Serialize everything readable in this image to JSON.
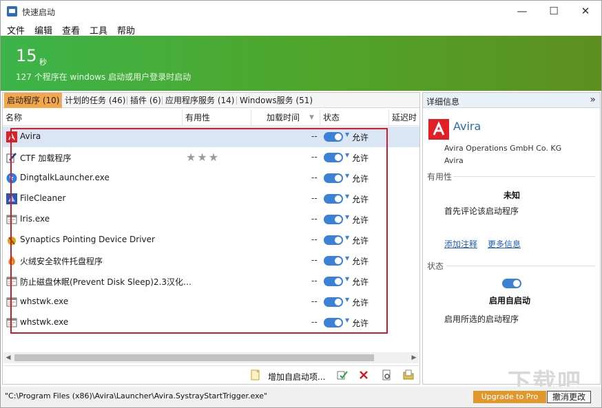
{
  "window": {
    "title": "快速启动",
    "min": "—",
    "max": "☐",
    "close": "✕"
  },
  "menu": [
    "文件",
    "编辑",
    "查看",
    "工具",
    "帮助"
  ],
  "hero": {
    "seconds": "15",
    "unit": "秒",
    "desc": "127 个程序在 windows 启动或用户登录时启动"
  },
  "tabs": [
    "启动程序 (10)",
    "计划的任务 (46)",
    "插件 (6)",
    "应用程序服务 (14)",
    "Windows服务 (51)"
  ],
  "columns": {
    "name": "名称",
    "usefulness": "有用性",
    "load_time": "加载时间",
    "status": "状态",
    "delay": "延迟时"
  },
  "rows": [
    {
      "name": "Avira",
      "time": "--",
      "status": "允许",
      "icon": "avira-icon"
    },
    {
      "name": "CTF 加载程序",
      "time": "--",
      "status": "允许",
      "icon": "pen-icon",
      "stars": "★★★"
    },
    {
      "name": "DingtalkLauncher.exe",
      "time": "--",
      "status": "允许",
      "icon": "dingtalk-icon"
    },
    {
      "name": "FileCleaner",
      "time": "--",
      "status": "允许",
      "icon": "filecleaner-icon"
    },
    {
      "name": "Iris.exe",
      "time": "--",
      "status": "允许",
      "icon": "window-icon"
    },
    {
      "name": "Synaptics Pointing Device Driver",
      "time": "--",
      "status": "允许",
      "icon": "synaptics-icon"
    },
    {
      "name": "火绒安全软件托盘程序",
      "time": "--",
      "status": "允许",
      "icon": "huorong-icon"
    },
    {
      "name": "防止磁盘休眠(Prevent Disk Sleep)2.3汉化…",
      "time": "--",
      "status": "允许",
      "icon": "window-icon"
    },
    {
      "name": "whstwk.exe",
      "time": "--",
      "status": "允许",
      "icon": "window-icon"
    },
    {
      "name": "whstwk.exe",
      "time": "--",
      "status": "允许",
      "icon": "window-icon"
    }
  ],
  "toolbar": {
    "add_label": "增加自启动项..."
  },
  "details": {
    "header": "详细信息",
    "collapse": "»",
    "app_name": "Avira",
    "company": "Avira Operations GmbH  Co. KG",
    "product": "Avira",
    "usefulness_section": "有用性",
    "usefulness_value": "未知",
    "usefulness_hint": "首先评论该启动程序",
    "add_note": "添加注释",
    "more_info": "更多信息",
    "status_section": "状态",
    "status_value": "启用自启动",
    "status_hint": "启用所选的启动程序"
  },
  "statusbar": {
    "path": "\"C:\\Program Files (x86)\\Avira\\Launcher\\Avira.SystrayStartTrigger.exe\"",
    "upgrade": "Upgrade to Pro",
    "undo": "撤消更改"
  },
  "watermark": "下载吧"
}
